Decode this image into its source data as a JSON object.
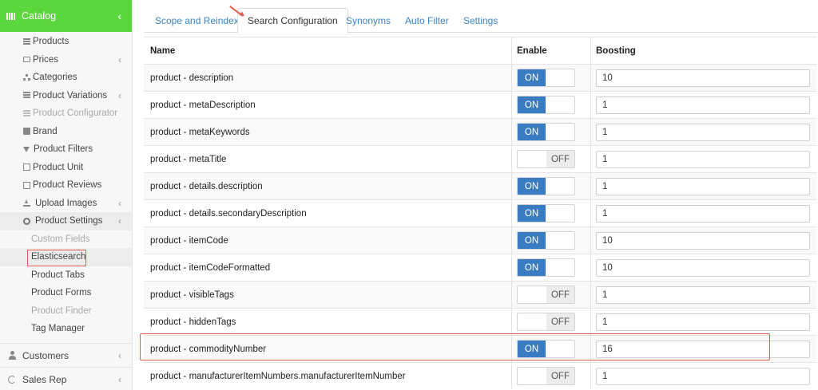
{
  "sidebar": {
    "header": "Catalog",
    "items": [
      {
        "label": "Products",
        "icon": "list-icon",
        "disabled": false
      },
      {
        "label": "Prices",
        "icon": "money-icon",
        "chevron": true
      },
      {
        "label": "Categories",
        "icon": "sitemap-icon"
      },
      {
        "label": "Product Variations",
        "icon": "list-icon",
        "chevron": true
      },
      {
        "label": "Product Configurator",
        "icon": "list-icon",
        "disabled": true
      },
      {
        "label": "Brand",
        "icon": "gift-icon"
      },
      {
        "label": "Product Filters",
        "icon": "filter-icon"
      },
      {
        "label": "Product Unit",
        "icon": "square-icon"
      },
      {
        "label": "Product Reviews",
        "icon": "edit-icon"
      },
      {
        "label": "Upload Images",
        "icon": "upload-icon",
        "chevron": true
      },
      {
        "label": "Product Settings",
        "icon": "gear-icon",
        "chevron": true
      }
    ],
    "sub_items": [
      {
        "label": "Custom Fields",
        "disabled": true
      },
      {
        "label": "Elasticsearch"
      },
      {
        "label": "Product Tabs"
      },
      {
        "label": "Product Forms"
      },
      {
        "label": "Product Finder",
        "disabled": true
      },
      {
        "label": "Tag Manager"
      }
    ],
    "bottom": [
      {
        "label": "Customers",
        "icon": "user-icon"
      },
      {
        "label": "Sales Rep",
        "icon": "refresh-icon"
      }
    ]
  },
  "tabs": [
    {
      "label": "Scope and Reindex"
    },
    {
      "label": "Search Configuration",
      "active": true
    },
    {
      "label": "Synonyms"
    },
    {
      "label": "Auto Filter"
    },
    {
      "label": "Settings"
    }
  ],
  "table": {
    "headers": {
      "name": "Name",
      "enable": "Enable",
      "boosting": "Boosting"
    },
    "toggle_labels": {
      "on": "ON",
      "off": "OFF"
    },
    "rows": [
      {
        "name": "product - description",
        "enabled": true,
        "boosting": "10"
      },
      {
        "name": "product - metaDescription",
        "enabled": true,
        "boosting": "1"
      },
      {
        "name": "product - metaKeywords",
        "enabled": true,
        "boosting": "1"
      },
      {
        "name": "product - metaTitle",
        "enabled": false,
        "boosting": "1"
      },
      {
        "name": "product - details.description",
        "enabled": true,
        "boosting": "1"
      },
      {
        "name": "product - details.secondaryDescription",
        "enabled": true,
        "boosting": "1"
      },
      {
        "name": "product - itemCode",
        "enabled": true,
        "boosting": "10"
      },
      {
        "name": "product - itemCodeFormatted",
        "enabled": true,
        "boosting": "10"
      },
      {
        "name": "product - visibleTags",
        "enabled": false,
        "boosting": "1"
      },
      {
        "name": "product - hiddenTags",
        "enabled": false,
        "boosting": "1"
      },
      {
        "name": "product - commodityNumber",
        "enabled": true,
        "boosting": "16"
      },
      {
        "name": "product - manufacturerItemNumbers.manufacturerItemNumber",
        "enabled": false,
        "boosting": "1"
      }
    ]
  },
  "colors": {
    "accent_green": "#5bd63c",
    "toggle_blue": "#3a7cc1",
    "link_blue": "#3b83c5",
    "annotation_red": "#e55a4e"
  }
}
